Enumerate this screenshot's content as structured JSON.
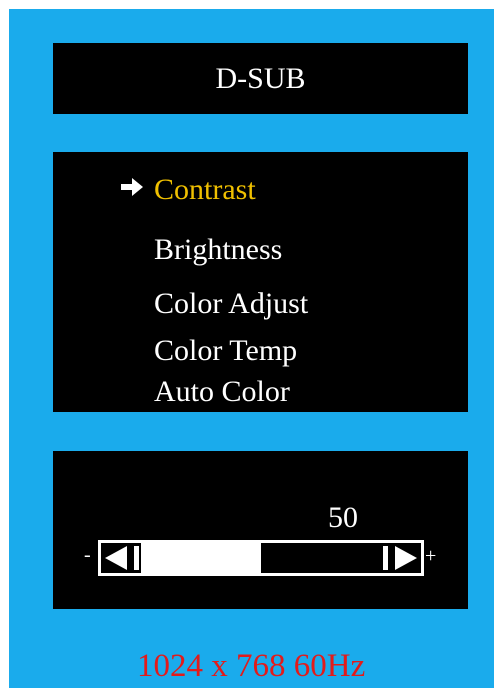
{
  "title": "D-SUB",
  "menu": {
    "items": [
      {
        "label": "Contrast",
        "selected": true
      },
      {
        "label": "Brightness",
        "selected": false
      },
      {
        "label": "Color Adjust",
        "selected": false
      },
      {
        "label": "Color Temp",
        "selected": false
      },
      {
        "label": "Auto Color",
        "selected": false
      }
    ],
    "selector_icon": "right-arrow-icon"
  },
  "adjust": {
    "value": "50",
    "level_percent": 50,
    "minus_label": "-",
    "plus_label": "+",
    "decrease_icon": "triangle-left-icon",
    "increase_icon": "triangle-right-icon"
  },
  "status": {
    "resolution": "1024 x 768  60Hz"
  },
  "colors": {
    "background": "#1aabec",
    "panel": "#000000",
    "selected_text": "#f0c000",
    "text": "#ffffff",
    "status_text": "#e21b1b"
  }
}
